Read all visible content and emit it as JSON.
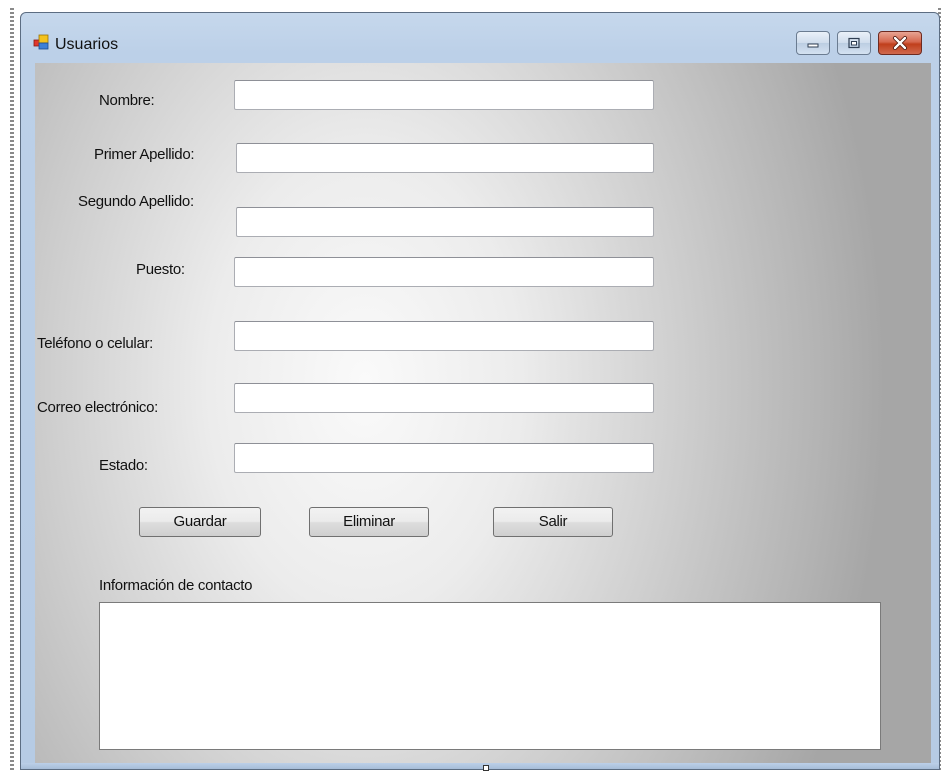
{
  "window": {
    "title": "Usuarios"
  },
  "form": {
    "nombre_label": "Nombre:",
    "primer_apellido_label": "Primer Apellido:",
    "segundo_apellido_label": "Segundo Apellido:",
    "puesto_label": "Puesto:",
    "telefono_label": "Teléfono o celular:",
    "correo_label": "Correo electrónico:",
    "estado_label": "Estado:",
    "nombre_value": "",
    "primer_apellido_value": "",
    "segundo_apellido_value": "",
    "puesto_value": "",
    "telefono_value": "",
    "correo_value": "",
    "estado_value": ""
  },
  "buttons": {
    "guardar": "Guardar",
    "eliminar": "Eliminar",
    "salir": "Salir"
  },
  "contact": {
    "label": "Información de contacto",
    "value": ""
  },
  "icons": {
    "app": "app-window-icon",
    "minimize": "minimize-icon",
    "maximize": "maximize-icon",
    "close": "close-icon"
  },
  "colors": {
    "close_button": "#c8462a",
    "title_bar": "#bcd0e8"
  }
}
